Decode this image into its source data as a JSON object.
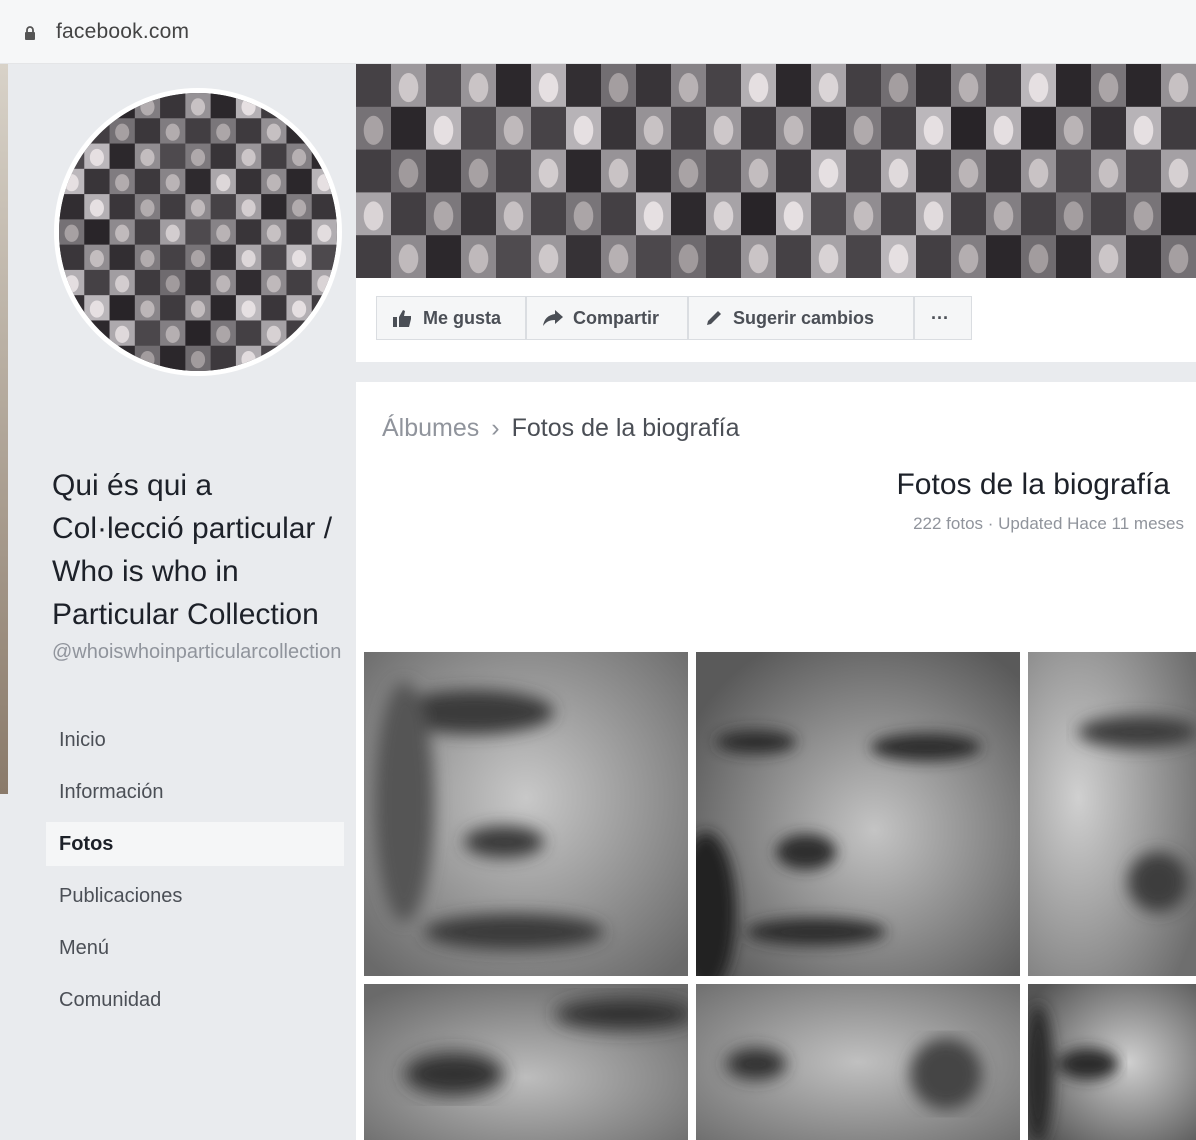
{
  "browser": {
    "url": "facebook.com",
    "lock_icon": "lock-icon"
  },
  "profile": {
    "name": "Qui és qui a Col·lecció particular / Who is who in Particular Collection",
    "handle": "@whoiswhoinparticularcollection"
  },
  "nav": {
    "items": [
      {
        "label": "Inicio"
      },
      {
        "label": "Información"
      },
      {
        "label": "Fotos",
        "active": true
      },
      {
        "label": "Publicaciones"
      },
      {
        "label": "Menú"
      },
      {
        "label": "Comunidad"
      }
    ]
  },
  "actions": {
    "like": "Me gusta",
    "share": "Compartir",
    "suggest": "Sugerir cambios",
    "more": "···"
  },
  "breadcrumb": {
    "parent": "Álbumes",
    "separator": "›",
    "current": "Fotos de la biografía"
  },
  "album": {
    "title": "Fotos de la biografía",
    "meta": "222 fotos · Updated Hace 11 meses"
  },
  "colors": {
    "page_bg": "#e9ebee",
    "text": "#1d2129",
    "muted": "#90949c"
  }
}
